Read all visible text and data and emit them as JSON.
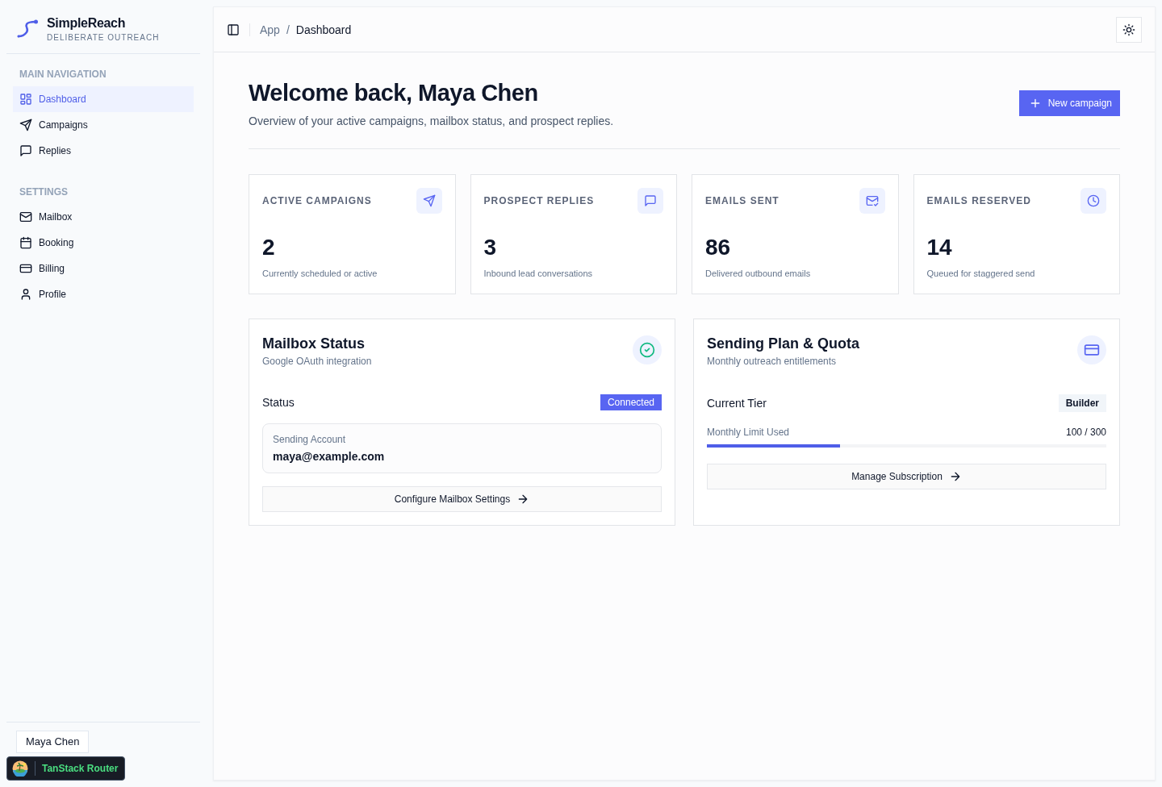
{
  "brand": {
    "name": "SimpleReach",
    "tagline": "DELIBERATE OUTREACH"
  },
  "nav_sections": [
    {
      "title": "MAIN NAVIGATION",
      "items": [
        {
          "label": "Dashboard",
          "selected": true
        },
        {
          "label": "Campaigns",
          "selected": false
        },
        {
          "label": "Replies",
          "selected": false
        }
      ]
    },
    {
      "title": "SETTINGS",
      "items": [
        {
          "label": "Mailbox",
          "selected": false
        },
        {
          "label": "Booking",
          "selected": false
        },
        {
          "label": "Billing",
          "selected": false
        },
        {
          "label": "Profile",
          "selected": false
        }
      ]
    }
  ],
  "user": {
    "name": "Maya Chen"
  },
  "devtools_badge": {
    "label": "TanStack Router"
  },
  "breadcrumbs": {
    "items": [
      "App",
      "Dashboard"
    ],
    "separator": "/"
  },
  "page": {
    "title": "Welcome back, Maya Chen",
    "subtitle": "Overview of your active campaigns, mailbox status, and prospect replies.",
    "primary_button": "New campaign"
  },
  "stats": [
    {
      "label": "ACTIVE CAMPAIGNS",
      "value": "2",
      "caption": "Currently scheduled or active"
    },
    {
      "label": "PROSPECT REPLIES",
      "value": "3",
      "caption": "Inbound lead conversations"
    },
    {
      "label": "EMAILS SENT",
      "value": "86",
      "caption": "Delivered outbound emails"
    },
    {
      "label": "EMAILS RESERVED",
      "value": "14",
      "caption": "Queued for staggered send"
    }
  ],
  "mailbox_card": {
    "title": "Mailbox Status",
    "subtitle": "Google OAuth integration",
    "status_label": "Status",
    "status_badge": "Connected",
    "account_label": "Sending Account",
    "account_value": "maya@example.com",
    "button": "Configure Mailbox Settings"
  },
  "plan_card": {
    "title": "Sending Plan & Quota",
    "subtitle": "Monthly outreach entitlements",
    "tier_label": "Current Tier",
    "tier_badge": "Builder",
    "usage_label": "Monthly Limit Used",
    "usage_reading": "100 / 300",
    "level": 0.3333,
    "button": "Manage Subscription"
  }
}
